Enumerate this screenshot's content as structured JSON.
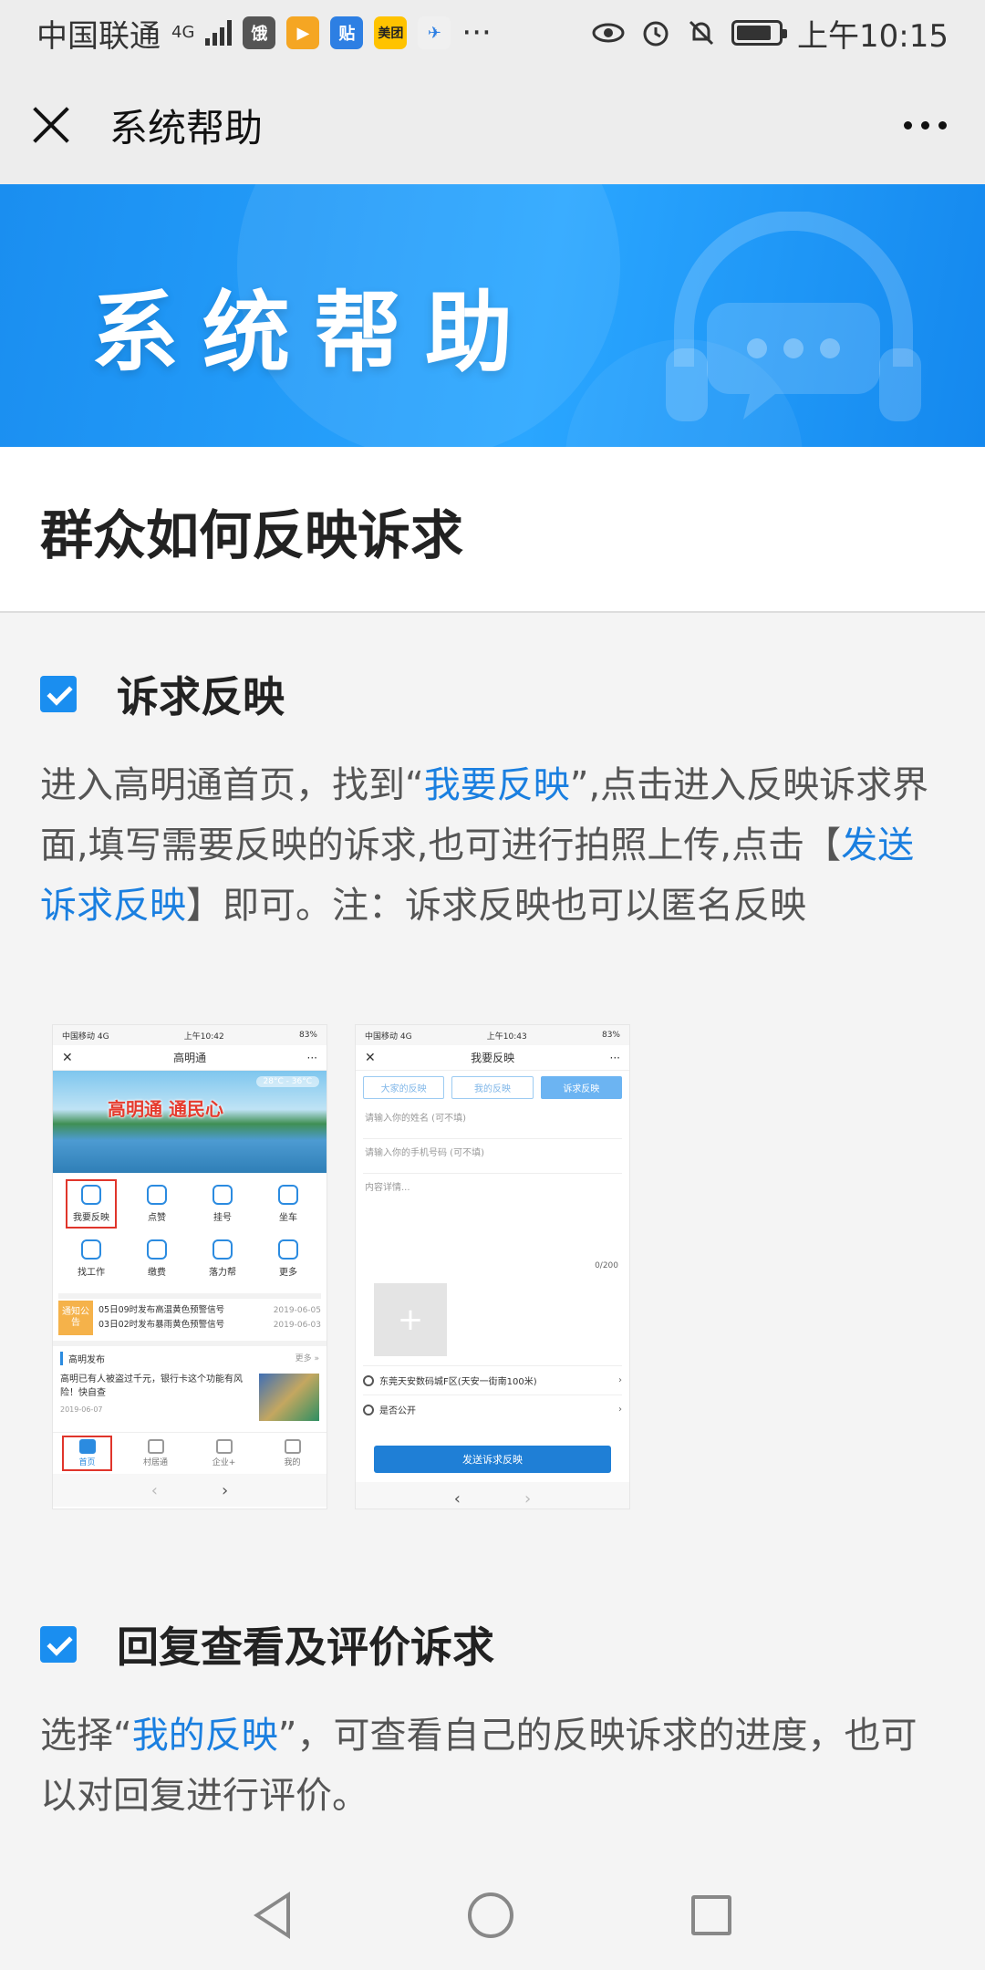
{
  "status_bar": {
    "carrier": "中国联通",
    "network": "4G",
    "app_badges": [
      "饿",
      "▶",
      "贴",
      "美团",
      "✈"
    ],
    "more": "···",
    "time": "上午10:15",
    "battery_level": 0.85
  },
  "header": {
    "title": "系统帮助"
  },
  "banner": {
    "title": "系统帮助"
  },
  "article": {
    "title": "群众如何反映诉求"
  },
  "section1": {
    "heading": "诉求反映",
    "text_before": "进入高明通首页，找到“",
    "link1": "我要反映",
    "text_mid": "”,点击进入反映诉求界面,填写需要反映的诉求,也可进行拍照上传,点击【",
    "link2": "发送诉求反映",
    "text_after": "】即可。注：诉求反映也可以匿名反映"
  },
  "mini1": {
    "carrier": "中国移动  4G",
    "time": "上午10:42",
    "battery": "83%",
    "title": "高明通",
    "slogan": "高明通  通民心",
    "weather": "28°C - 36°C",
    "grid": [
      "我要反映",
      "点赞",
      "挂号",
      "坐车",
      "找工作",
      "缴费",
      "落力帮",
      "更多"
    ],
    "notice_tag": "通知公告",
    "notices": [
      {
        "text": "05日09时发布高温黄色预警信号",
        "date": "2019-06-05"
      },
      {
        "text": "03日02时发布暴雨黄色预警信号",
        "date": "2019-06-03"
      }
    ],
    "news_heading": "高明发布",
    "news_more": "更多 »",
    "news_text": "高明已有人被盗过千元，银行卡这个功能有风险！快自查",
    "news_date": "2019-06-07",
    "tabs": [
      "首页",
      "村居通",
      "企业+",
      "我的"
    ],
    "nav_left": "‹",
    "nav_right": "›"
  },
  "mini2": {
    "carrier": "中国移动  4G",
    "time": "上午10:43",
    "battery": "83%",
    "title": "我要反映",
    "segments": [
      "大家的反映",
      "我的反映",
      "诉求反映"
    ],
    "name_placeholder": "请输入你的姓名 (可不填)",
    "phone_placeholder": "请输入你的手机号码 (可不填)",
    "content_placeholder": "内容详情...",
    "counter": "0/200",
    "location": "东莞天安数码城F区(天安一街南100米)",
    "public_label": "是否公开",
    "submit": "发送诉求反映",
    "nav_left": "‹",
    "nav_right": "›"
  },
  "section2": {
    "heading": "回复查看及评价诉求",
    "text_before": "选择“",
    "link": "我的反映",
    "text_after": "”，可查看自己的反映诉求的进度，也可以对回复进行评价。"
  },
  "colors": {
    "accent": "#1a8ef0",
    "link": "#1a7fe0",
    "banner_start": "#1a8ef0",
    "banner_end": "#2aa6ff"
  }
}
